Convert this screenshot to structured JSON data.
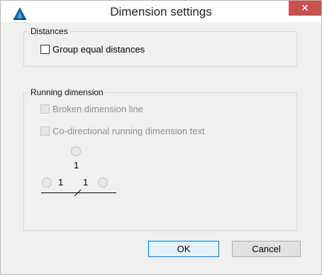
{
  "window": {
    "title": "Dimension settings",
    "close_glyph": "✕"
  },
  "distances": {
    "legend": "Distances",
    "group_equal": {
      "label": "Group equal distances",
      "checked": false
    }
  },
  "running": {
    "legend": "Running dimension",
    "broken_line": {
      "label": "Broken dimension line",
      "checked": false,
      "enabled": false
    },
    "codirectional": {
      "label": "Co-directional running dimension text",
      "checked": false,
      "enabled": false
    },
    "diagram": {
      "top_value": "1",
      "left_value": "1",
      "right_value": "1"
    }
  },
  "buttons": {
    "ok": "OK",
    "cancel": "Cancel"
  },
  "colors": {
    "close_bg": "#c75050",
    "disabled_text": "#8e8e8e",
    "default_button_border": "#0078d7"
  }
}
